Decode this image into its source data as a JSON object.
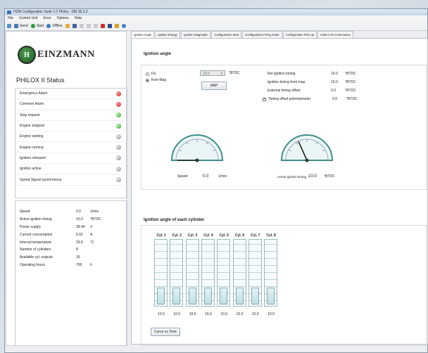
{
  "window": {
    "title": "HZM Configuration Suite 1.0 Philos - DM 35.3.2"
  },
  "menu": [
    "File",
    "Control Unit",
    "Error",
    "Options",
    "Help"
  ],
  "toolbar": {
    "send": "Send",
    "start": "Start",
    "offline": "Offline"
  },
  "logo": {
    "letter": "H",
    "text": "EINZMANN"
  },
  "status": {
    "title": "PHILOX II Status",
    "items": [
      {
        "label": "Emergency Alarm",
        "state": "red"
      },
      {
        "label": "Common Alarm",
        "state": "red"
      },
      {
        "label": "Stop request",
        "state": "green"
      },
      {
        "label": "Engine stopped",
        "state": "green"
      },
      {
        "label": "Engine starting",
        "state": "gray"
      },
      {
        "label": "Engine running",
        "state": "gray"
      },
      {
        "label": "Ignition released",
        "state": "gray"
      },
      {
        "label": "Ignition active",
        "state": "gray"
      },
      {
        "label": "Speed Signal synchronous",
        "state": "gray"
      }
    ]
  },
  "values": [
    {
      "label": "Speed",
      "value": "0.0",
      "unit": "1/min"
    },
    {
      "label": "Active ignition timing",
      "value": "10.0",
      "unit": "°BTDC"
    },
    {
      "label": "Power supply",
      "value": "28.44",
      "unit": "V"
    },
    {
      "label": "Current consumption",
      "value": "0.02",
      "unit": "A"
    },
    {
      "label": "Internal temperature",
      "value": "29.8",
      "unit": "°C"
    },
    {
      "label": "Number of cylinders",
      "value": "8",
      "unit": ""
    },
    {
      "label": "Available cyl. outputs",
      "value": "16",
      "unit": ""
    },
    {
      "label": "Operating hours",
      "value": "765",
      "unit": "h"
    }
  ],
  "tabs": [
    "Ignition Angle",
    "Ignition Energy",
    "Ignition Diagnostic",
    "Configuration Start",
    "Configuration Firing Order",
    "Configuration Pick Up",
    "HZM CAN Communica"
  ],
  "ignition_angle": {
    "title": "Ignition angle",
    "fix_label": "Fix",
    "map_label": "from Map",
    "fix_value": "10.0",
    "fix_unit": "°BTDC",
    "map_button": "MAP",
    "info": [
      {
        "label": "Rel ignition timing",
        "value": "10.0",
        "unit": "°BTDC",
        "checkbox": false
      },
      {
        "label": "Ignition timing from map",
        "value": "10.0",
        "unit": "°BTDC",
        "checkbox": false
      },
      {
        "label": "External timing offset",
        "value": "0.0",
        "unit": "°BTDC",
        "checkbox": false
      },
      {
        "label": "Timing offset potentiometer",
        "value": "0.0",
        "unit": "°BTDC",
        "checkbox": true
      }
    ],
    "speed_label": "Speed",
    "speed_value": "0.0",
    "speed_unit": "1/min",
    "active_label": "Active ignition timing",
    "active_value": "10.0",
    "active_unit": "°BTDC"
  },
  "cylinders": {
    "title": "Ignition angle of each cylinder",
    "items": [
      {
        "name": "Cyl. 1",
        "value": "10.0"
      },
      {
        "name": "Cyl. 2",
        "value": "10.0"
      },
      {
        "name": "Cyl. 3",
        "value": "10.0"
      },
      {
        "name": "Cyl. 4",
        "value": "10.0"
      },
      {
        "name": "Cyl. 5",
        "value": "10.0"
      },
      {
        "name": "Cyl. 6",
        "value": "10.0"
      },
      {
        "name": "Cyl. 7",
        "value": "10.0"
      },
      {
        "name": "Cyl. 8",
        "value": "10.0"
      }
    ],
    "button": "Curve vs Time"
  }
}
